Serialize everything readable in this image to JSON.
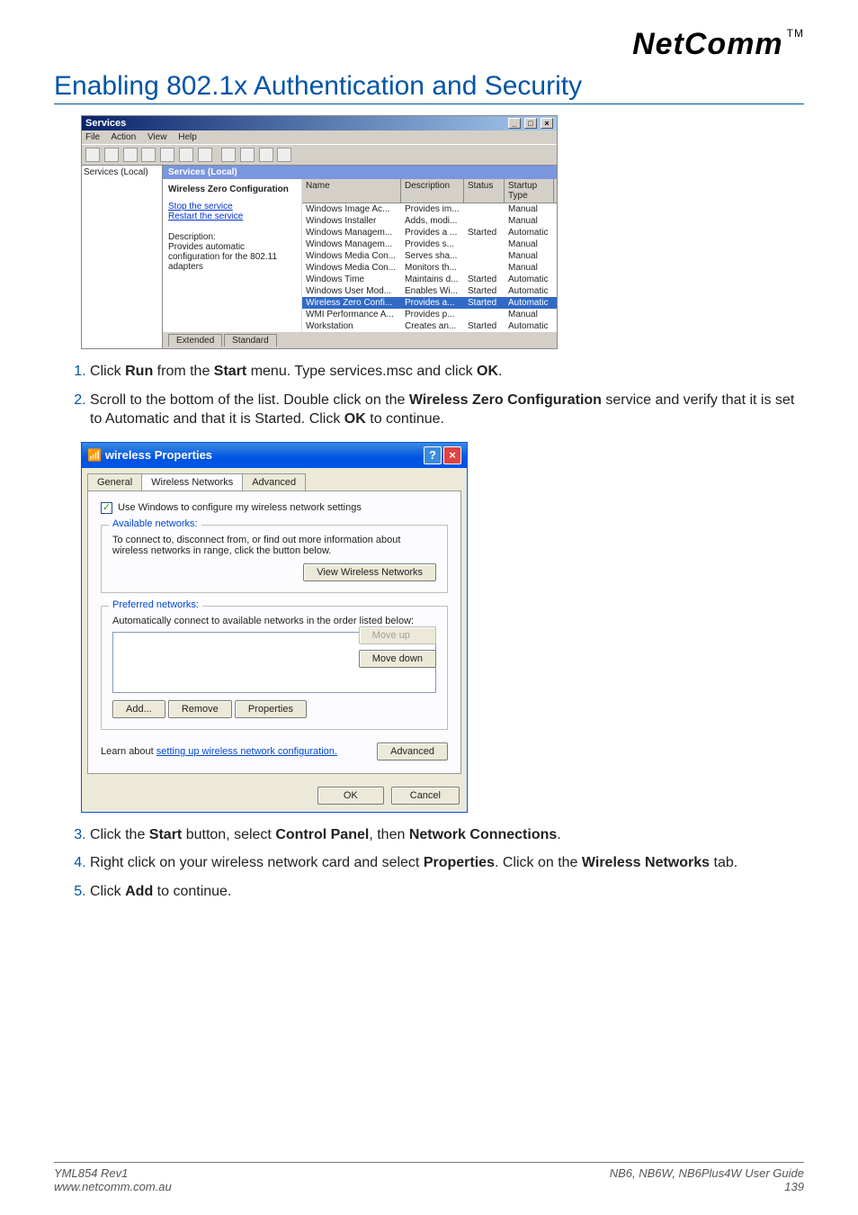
{
  "brand": {
    "name": "NetComm",
    "tm": "TM"
  },
  "page_title": "Enabling 802.1x Authentication and Security",
  "services_window": {
    "title": "Services",
    "menu": [
      "File",
      "Action",
      "View",
      "Help"
    ],
    "tree_label": "Services (Local)",
    "pane_header": "Services (Local)",
    "selected_service_heading": "Wireless Zero Configuration",
    "link_stop": "Stop the service",
    "link_restart": "Restart the service",
    "desc_label": "Description:",
    "desc_text": "Provides automatic configuration for the 802.11 adapters",
    "columns": [
      "Name",
      "Description",
      "Status",
      "Startup Type"
    ],
    "rows": [
      {
        "name": "Windows Image Ac...",
        "desc": "Provides im...",
        "status": "",
        "type": "Manual"
      },
      {
        "name": "Windows Installer",
        "desc": "Adds, modi...",
        "status": "",
        "type": "Manual"
      },
      {
        "name": "Windows Managem...",
        "desc": "Provides a ...",
        "status": "Started",
        "type": "Automatic"
      },
      {
        "name": "Windows Managem...",
        "desc": "Provides s...",
        "status": "",
        "type": "Manual"
      },
      {
        "name": "Windows Media Con...",
        "desc": "Serves sha...",
        "status": "",
        "type": "Manual"
      },
      {
        "name": "Windows Media Con...",
        "desc": "Monitors th...",
        "status": "",
        "type": "Manual"
      },
      {
        "name": "Windows Time",
        "desc": "Maintains d...",
        "status": "Started",
        "type": "Automatic"
      },
      {
        "name": "Windows User Mod...",
        "desc": "Enables Wi...",
        "status": "Started",
        "type": "Automatic"
      },
      {
        "name": "Wireless Zero Confi...",
        "desc": "Provides a...",
        "status": "Started",
        "type": "Automatic",
        "highlight": true
      },
      {
        "name": "WMI Performance A...",
        "desc": "Provides p...",
        "status": "",
        "type": "Manual"
      },
      {
        "name": "Workstation",
        "desc": "Creates an...",
        "status": "Started",
        "type": "Automatic"
      }
    ],
    "tabs": [
      "Extended",
      "Standard"
    ]
  },
  "steps_a": [
    {
      "n": "1.",
      "html": "Click <b>Run</b> from the <b>Start</b> menu. Type services.msc and click <b>OK</b>."
    },
    {
      "n": "2.",
      "html": "Scroll to the bottom of the list. Double click on the <b>Wireless Zero Configuration</b> service and verify that it is set to Automatic and that it is Started. Click <b>OK</b> to continue."
    }
  ],
  "props_window": {
    "title": "wireless Properties",
    "tabs": [
      "General",
      "Wireless Networks",
      "Advanced"
    ],
    "active_tab": 1,
    "checkbox_label": "Use Windows to configure my wireless network settings",
    "grp1_title": "Available networks:",
    "grp1_text": "To connect to, disconnect from, or find out more information about wireless networks in range, click the button below.",
    "btn_view": "View Wireless Networks",
    "grp2_title": "Preferred networks:",
    "grp2_text": "Automatically connect to available networks in the order listed below:",
    "btn_moveup": "Move up",
    "btn_movedown": "Move down",
    "btn_add": "Add...",
    "btn_remove": "Remove",
    "btn_properties": "Properties",
    "learn_text": "Learn about ",
    "learn_link": "setting up wireless network configuration.",
    "btn_advanced": "Advanced",
    "btn_ok": "OK",
    "btn_cancel": "Cancel"
  },
  "steps_b": [
    {
      "n": "3.",
      "html": "Click the <b>Start</b> button, select <b>Control Panel</b>, then <b>Network Connections</b>."
    },
    {
      "n": "4.",
      "html": "Right click on your wireless network card and select <b>Properties</b>. Click on the <b>Wireless Networks</b> tab."
    },
    {
      "n": "5.",
      "html": "Click <b>Add</b> to continue."
    }
  ],
  "footer": {
    "left_line1": "YML854 Rev1",
    "left_line2": "www.netcomm.com.au",
    "right_line1_prefix": "NB6, NB6W, NB6Plus4W ",
    "right_line1_suffix": "User Guide",
    "right_line2": "139"
  }
}
